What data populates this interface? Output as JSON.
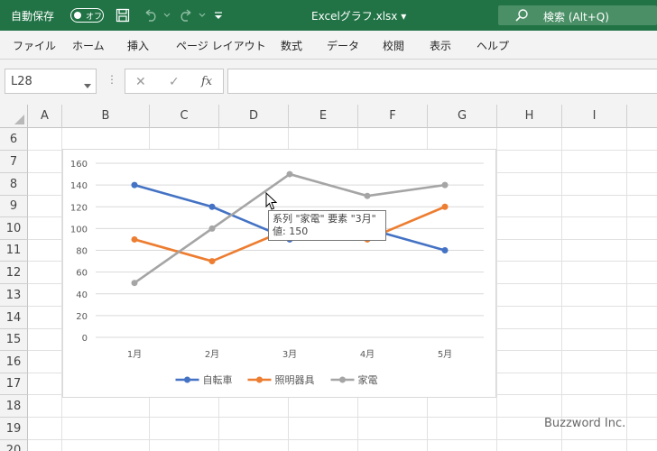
{
  "titlebar": {
    "autosave_label": "自動保存",
    "autosave_state": "オフ",
    "filename": "Excelグラフ.xlsx",
    "filename_caret": "▾",
    "search_placeholder": "検索 (Alt+Q)",
    "icons": [
      "save-icon",
      "undo-icon",
      "redo-icon",
      "customize-icon",
      "search-icon"
    ]
  },
  "ribbon": {
    "tabs": [
      "ファイル",
      "ホーム",
      "挿入",
      "ページ レイアウト",
      "数式",
      "データ",
      "校閲",
      "表示",
      "ヘルプ"
    ]
  },
  "formula_bar": {
    "name_box": "L28",
    "formula": "",
    "fx_label": "fx",
    "cancel_glyph": "✕",
    "enter_glyph": "✓",
    "more_glyph": "⋮"
  },
  "sheet": {
    "columns": [
      "A",
      "B",
      "C",
      "D",
      "E",
      "F",
      "G",
      "H",
      "I"
    ],
    "rows": [
      "6",
      "7",
      "8",
      "9",
      "10",
      "11",
      "12",
      "13",
      "14",
      "15",
      "16",
      "17",
      "18",
      "19",
      "20"
    ]
  },
  "chart_data": {
    "type": "line",
    "title": "",
    "xlabel": "",
    "ylabel": "",
    "categories": [
      "1月",
      "2月",
      "3月",
      "4月",
      "5月"
    ],
    "series": [
      {
        "name": "自転車",
        "color": "#4472c4",
        "values": [
          140,
          120,
          90,
          100,
          80
        ]
      },
      {
        "name": "照明器具",
        "color": "#ed7d31",
        "values": [
          90,
          70,
          100,
          90,
          120
        ]
      },
      {
        "name": "家電",
        "color": "#a5a5a5",
        "values": [
          50,
          100,
          150,
          130,
          140
        ]
      }
    ],
    "ylim": [
      0,
      160
    ],
    "yticks": [
      "0",
      "20",
      "40",
      "60",
      "80",
      "100",
      "120",
      "140",
      "160"
    ],
    "grid": true,
    "legend": "bottom"
  },
  "tooltip": {
    "line1": "系列 \"家電\" 要素 \"3月\"",
    "line2": "値: 150"
  },
  "watermark": "Buzzword Inc."
}
